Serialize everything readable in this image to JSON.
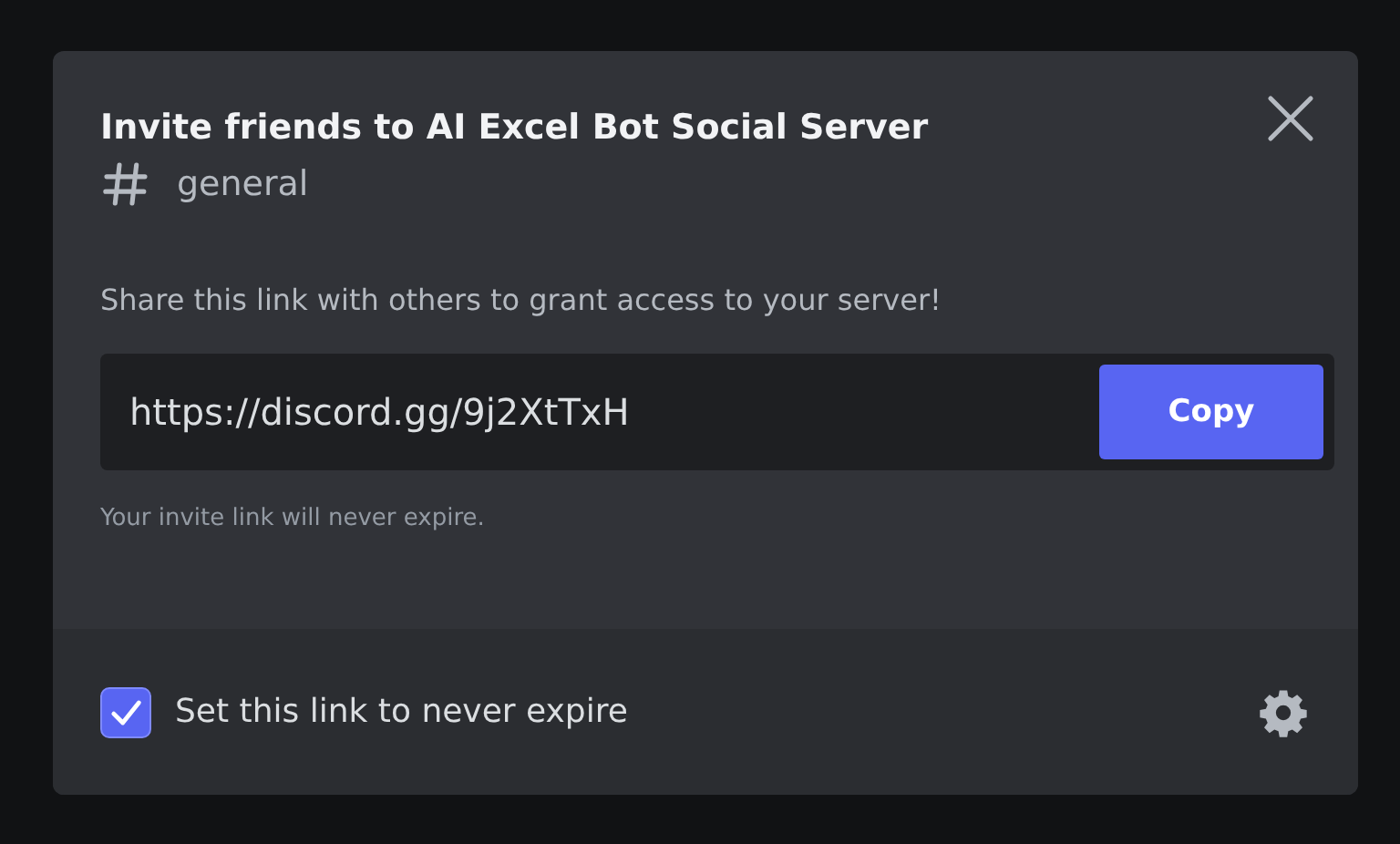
{
  "modal": {
    "title": "Invite friends to AI Excel Bot Social Server",
    "channel": "general",
    "description": "Share this link with others to grant access to your server!",
    "invite_link": "https://discord.gg/9j2XtTxH",
    "copy_button": "Copy",
    "hint": "Your invite link will never expire.",
    "never_expire": {
      "label": "Set this link to never expire",
      "checked": true
    }
  }
}
